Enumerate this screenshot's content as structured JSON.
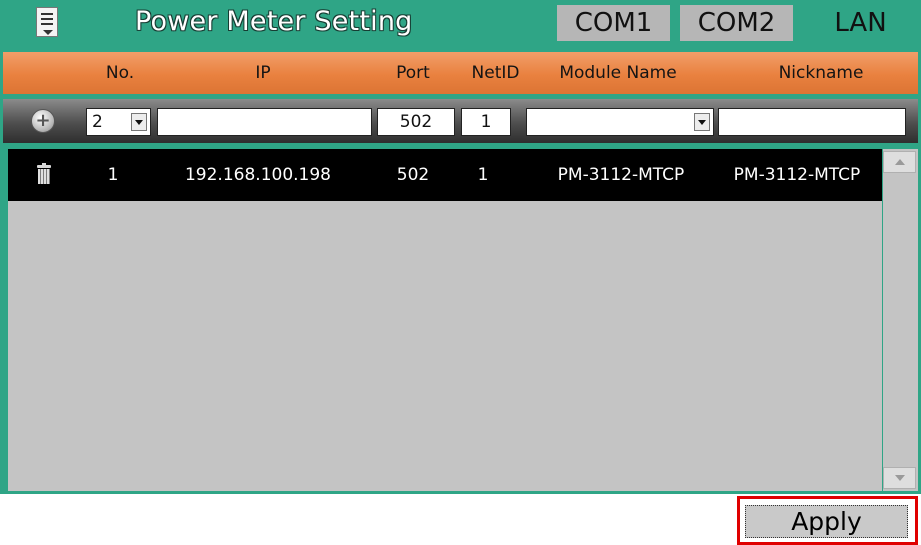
{
  "title": "Power Meter Setting",
  "tabs": {
    "com1": "COM1",
    "com2": "COM2",
    "lan": "LAN",
    "active": "LAN"
  },
  "columns": {
    "no": "No.",
    "ip": "IP",
    "port": "Port",
    "netid": "NetID",
    "module": "Module Name",
    "nickname": "Nickname"
  },
  "add_row": {
    "no_value": "2",
    "ip_value": "",
    "port_value": "502",
    "netid_value": "1",
    "module_value": "",
    "nickname_value": ""
  },
  "rows": [
    {
      "no": "1",
      "ip": "192.168.100.198",
      "port": "502",
      "netid": "1",
      "module": "PM-3112-MTCP",
      "nickname": "PM-3112-MTCP"
    }
  ],
  "apply_label": "Apply",
  "colors": {
    "frame": "#2fa586",
    "header": "#e9813f",
    "highlight": "#e00000"
  }
}
